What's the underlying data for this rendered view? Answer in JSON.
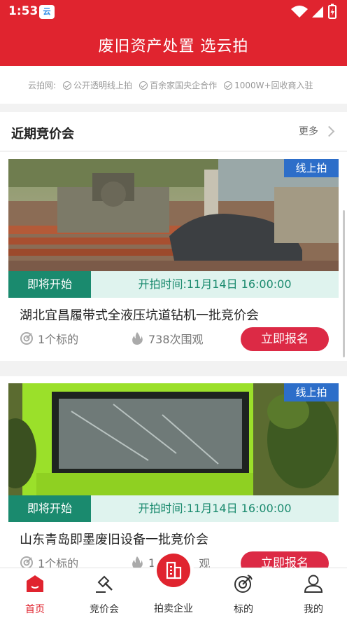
{
  "status_bar": {
    "time": "1:53",
    "app_icon_text": "云"
  },
  "header": {
    "title": "废旧资产处置  选云拍"
  },
  "promo": {
    "prefix": "云拍网:",
    "items": [
      "公开透明线上拍",
      "百余家国央企合作",
      "1000W+回收商入驻"
    ]
  },
  "section": {
    "title": "近期竞价会",
    "more": "更多"
  },
  "cards": [
    {
      "badge": "线上拍",
      "status": "即将开始",
      "start_time": "开拍时间:11月14日 16:00:00",
      "title": "湖北宜昌履带式全液压坑道钻机一批竞价会",
      "targets": "1个标的",
      "views": "738次围观",
      "button": "立即报名"
    },
    {
      "badge": "线上拍",
      "status": "即将开始",
      "start_time": "开拍时间:11月14日 16:00:00",
      "title": "山东青岛即墨废旧设备一批竞价会",
      "targets": "1个标的",
      "views": "1",
      "views_suffix": "观",
      "button": "立即报名"
    }
  ],
  "nav": {
    "items": [
      {
        "label": "首页",
        "icon": "home-icon",
        "active": true
      },
      {
        "label": "竞价会",
        "icon": "gavel-icon",
        "active": false
      },
      {
        "label": "拍卖企业",
        "icon": "building-icon",
        "active": false
      },
      {
        "label": "标的",
        "icon": "target-icon",
        "active": false
      },
      {
        "label": "我的",
        "icon": "user-icon",
        "active": false
      }
    ]
  },
  "colors": {
    "brand_red": "#e0242f",
    "badge_blue": "#2d6ec9",
    "status_green": "#1a8a6e",
    "button_red": "#dc2a45"
  }
}
